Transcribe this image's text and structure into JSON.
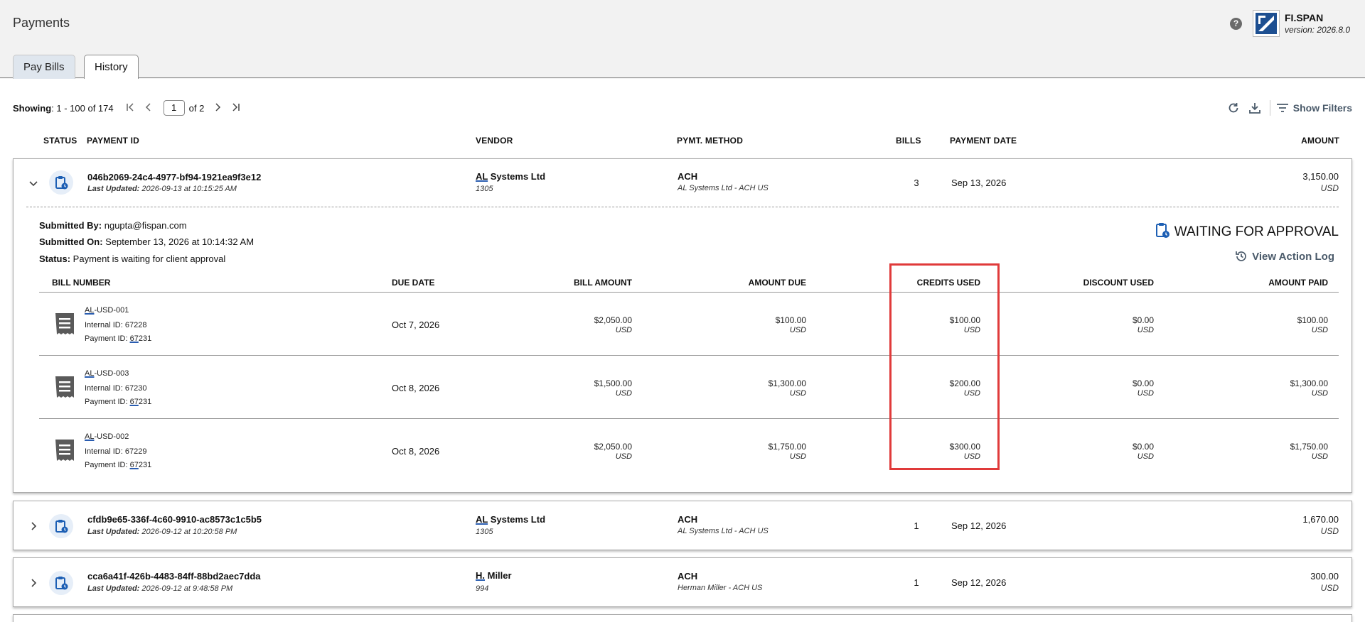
{
  "page": {
    "title": "Payments",
    "help": "?"
  },
  "brand": {
    "name": "FI.SPAN",
    "version": "version: 2026.8.0"
  },
  "tabs": [
    {
      "label": "Pay Bills"
    },
    {
      "label": "History"
    }
  ],
  "toolbar": {
    "showing_label": "Showing",
    "showing_value": ": 1 - 100 of 174",
    "page_value": "1",
    "page_of": "of 2",
    "show_filters": "Show Filters"
  },
  "columns": {
    "status": "STATUS",
    "payment_id": "PAYMENT ID",
    "vendor": "VENDOR",
    "method": "PYMT. METHOD",
    "bills": "BILLS",
    "payment_date": "PAYMENT DATE",
    "amount": "AMOUNT"
  },
  "payments": [
    {
      "id": "046b2069-24c4-4977-bf94-1921ea9f3e12",
      "last_updated_label": "Last Updated:",
      "last_updated": "2026-09-13 at 10:15:25 AM",
      "vendor_abbr": "AL",
      "vendor_rest": " Systems Ltd",
      "vendor_id": "1305",
      "method": "ACH",
      "method_sub": "AL Systems Ltd - ACH US",
      "bills": "3",
      "date": "Sep 13, 2026",
      "amount": "3,150.00",
      "currency": "USD"
    },
    {
      "id": "cfdb9e65-336f-4c60-9910-ac8573c1c5b5",
      "last_updated_label": "Last Updated:",
      "last_updated": "2026-09-12 at 10:20:58 PM",
      "vendor_abbr": "AL",
      "vendor_rest": " Systems Ltd",
      "vendor_id": "1305",
      "method": "ACH",
      "method_sub": "AL Systems Ltd - ACH US",
      "bills": "1",
      "date": "Sep 12, 2026",
      "amount": "1,670.00",
      "currency": "USD"
    },
    {
      "id": "cca6a41f-426b-4483-84ff-88bd2aec7dda",
      "last_updated_label": "Last Updated:",
      "last_updated": "2026-09-12 at 9:48:58 PM",
      "vendor_abbr": "H.",
      "vendor_rest": " Miller",
      "vendor_id": "994",
      "method": "ACH",
      "method_sub": "Herman Miller - ACH US",
      "bills": "1",
      "date": "Sep 12, 2026",
      "amount": "300.00",
      "currency": "USD"
    }
  ],
  "details": {
    "submitted_by_label": "Submitted By:",
    "submitted_by": " ngupta@fispan.com",
    "submitted_on_label": "Submitted On:",
    "submitted_on": " September 13, 2026 at 10:14:32 AM",
    "status_label": "Status:",
    "status": " Payment is waiting for client approval",
    "status_badge": "WAITING FOR APPROVAL",
    "action_log": "View Action Log"
  },
  "bill_columns": {
    "bill_number": "BILL NUMBER",
    "due_date": "DUE DATE",
    "bill_amount": "BILL AMOUNT",
    "amount_due": "AMOUNT DUE",
    "credits_used": "CREDITS USED",
    "discount_used": "DISCOUNT USED",
    "amount_paid": "AMOUNT PAID"
  },
  "bills": [
    {
      "num_abbr": "AL",
      "num_rest": "-USD-001",
      "internal": "Internal ID: 67228",
      "pid_label": "Payment ID: ",
      "pid_ul": "67",
      "pid_rest": "231",
      "due": "Oct 7, 2026",
      "bill_amount": "$2,050.00",
      "amount_due": "$100.00",
      "credits": "$100.00",
      "discount": "$0.00",
      "paid": "$100.00",
      "cur": "USD"
    },
    {
      "num_abbr": "AL",
      "num_rest": "-USD-003",
      "internal": "Internal ID: 67230",
      "pid_label": "Payment ID: ",
      "pid_ul": "67",
      "pid_rest": "231",
      "due": "Oct 8, 2026",
      "bill_amount": "$1,500.00",
      "amount_due": "$1,300.00",
      "credits": "$200.00",
      "discount": "$0.00",
      "paid": "$1,300.00",
      "cur": "USD"
    },
    {
      "num_abbr": "AL",
      "num_rest": "-USD-002",
      "internal": "Internal ID: 67229",
      "pid_label": "Payment ID: ",
      "pid_ul": "67",
      "pid_rest": "231",
      "due": "Oct 8, 2026",
      "bill_amount": "$2,050.00",
      "amount_due": "$1,750.00",
      "credits": "$300.00",
      "discount": "$0.00",
      "paid": "$1,750.00",
      "cur": "USD"
    }
  ],
  "colors": {
    "accent": "#2a5db0",
    "highlight": "#e03a3a",
    "icon_bg": "#e6eef8"
  }
}
